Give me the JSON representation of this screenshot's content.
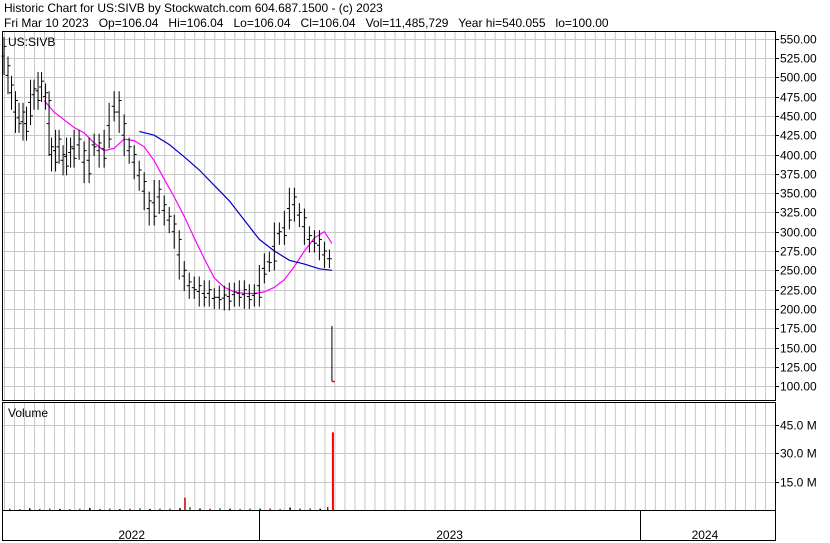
{
  "header": {
    "line1": "Historic Chart for US:SIVB by Stockwatch.com 604.687.1500 - (c) 2023",
    "line2": "Fri Mar 10 2023   Op=106.04   Hi=106.04   Lo=106.04   Cl=106.04   Vol=11,485,729   Year hi=540.055   lo=100.00"
  },
  "chart_data": {
    "type": "line",
    "title": "",
    "symbol_label": "US:SIVB",
    "volume_label": "Volume",
    "ylim": [
      82,
      560
    ],
    "yticks": [
      "550.00",
      "525.00",
      "500.00",
      "475.00",
      "450.00",
      "425.00",
      "400.00",
      "375.00",
      "350.00",
      "325.00",
      "300.00",
      "275.00",
      "250.00",
      "225.00",
      "200.00",
      "175.00",
      "150.00",
      "125.00",
      "100.00"
    ],
    "vol_ylim": [
      0,
      57
    ],
    "vol_ticks": [
      {
        "value": 45,
        "label": "45.0 M"
      },
      {
        "value": 30,
        "label": "30.0 M"
      },
      {
        "value": 15,
        "label": "15.0 M"
      }
    ],
    "x_periods": [
      {
        "label": "2022",
        "start": 0,
        "end": 51
      },
      {
        "label": "2023",
        "start": 51,
        "end": 127
      },
      {
        "label": "2024",
        "start": 127,
        "end": 153
      }
    ],
    "x_range": [
      0,
      153
    ],
    "price_points": [
      [
        0,
        540
      ],
      [
        0.8,
        515
      ],
      [
        1.5,
        490
      ],
      [
        2.3,
        470
      ],
      [
        3,
        440
      ],
      [
        3.8,
        455
      ],
      [
        4.5,
        430
      ],
      [
        5.3,
        450
      ],
      [
        6,
        485
      ],
      [
        6.8,
        470
      ],
      [
        7.5,
        495
      ],
      [
        8.3,
        480
      ],
      [
        9,
        470
      ],
      [
        9.5,
        410
      ],
      [
        10.3,
        390
      ],
      [
        11,
        420
      ],
      [
        11.8,
        400
      ],
      [
        12.5,
        385
      ],
      [
        13.3,
        410
      ],
      [
        14,
        395
      ],
      [
        15,
        420
      ],
      [
        16,
        405
      ],
      [
        17,
        375
      ],
      [
        18,
        410
      ],
      [
        19,
        415
      ],
      [
        20,
        395
      ],
      [
        21,
        420
      ],
      [
        22,
        455
      ],
      [
        23,
        470
      ],
      [
        24,
        440
      ],
      [
        25,
        410
      ],
      [
        26,
        400
      ],
      [
        27,
        380
      ],
      [
        28,
        365
      ],
      [
        29,
        340
      ],
      [
        30,
        320
      ],
      [
        31,
        355
      ],
      [
        32,
        335
      ],
      [
        33,
        320
      ],
      [
        34,
        310
      ],
      [
        35,
        290
      ],
      [
        36,
        250
      ],
      [
        37,
        235
      ],
      [
        38,
        225
      ],
      [
        39,
        230
      ],
      [
        40,
        215
      ],
      [
        41,
        225
      ],
      [
        42,
        215
      ],
      [
        43,
        212
      ],
      [
        44,
        218
      ],
      [
        45,
        210
      ],
      [
        46,
        222
      ],
      [
        47,
        215
      ],
      [
        48,
        225
      ],
      [
        49,
        212
      ],
      [
        50,
        220
      ],
      [
        51,
        215
      ],
      [
        52,
        245
      ],
      [
        53,
        260
      ],
      [
        54,
        262
      ],
      [
        55,
        300
      ],
      [
        56,
        295
      ],
      [
        57,
        315
      ],
      [
        58,
        345
      ],
      [
        59,
        325
      ],
      [
        60,
        318
      ],
      [
        61,
        295
      ],
      [
        62,
        285
      ],
      [
        63,
        290
      ],
      [
        64,
        275
      ],
      [
        65,
        265
      ],
      [
        65.5,
        106
      ]
    ],
    "ma_short": [
      [
        8,
        470
      ],
      [
        10,
        455
      ],
      [
        12,
        445
      ],
      [
        14,
        435
      ],
      [
        16,
        428
      ],
      [
        18,
        415
      ],
      [
        20,
        405
      ],
      [
        22,
        408
      ],
      [
        24,
        420
      ],
      [
        26,
        418
      ],
      [
        28,
        410
      ],
      [
        30,
        392
      ],
      [
        32,
        368
      ],
      [
        34,
        345
      ],
      [
        36,
        320
      ],
      [
        38,
        292
      ],
      [
        40,
        265
      ],
      [
        42,
        240
      ],
      [
        44,
        228
      ],
      [
        46,
        222
      ],
      [
        48,
        220
      ],
      [
        50,
        220
      ],
      [
        52,
        222
      ],
      [
        54,
        228
      ],
      [
        56,
        238
      ],
      [
        58,
        255
      ],
      [
        60,
        275
      ],
      [
        62,
        292
      ],
      [
        64,
        300
      ],
      [
        65.5,
        285
      ]
    ],
    "ma_long": [
      [
        27,
        430
      ],
      [
        30,
        425
      ],
      [
        33,
        413
      ],
      [
        36,
        397
      ],
      [
        39,
        380
      ],
      [
        42,
        360
      ],
      [
        45,
        340
      ],
      [
        48,
        315
      ],
      [
        51,
        290
      ],
      [
        54,
        275
      ],
      [
        57,
        263
      ],
      [
        60,
        258
      ],
      [
        63,
        252
      ],
      [
        65.5,
        250
      ]
    ],
    "volume_bars": [
      [
        1,
        0.7
      ],
      [
        3,
        0.5
      ],
      [
        5,
        0.9
      ],
      [
        7,
        0.6
      ],
      [
        9,
        0.8
      ],
      [
        11,
        0.6
      ],
      [
        13,
        0.5
      ],
      [
        15,
        0.7
      ],
      [
        17,
        1.1
      ],
      [
        19,
        0.6
      ],
      [
        21,
        0.8
      ],
      [
        23,
        0.5
      ],
      [
        25,
        0.7
      ],
      [
        27,
        0.9
      ],
      [
        29,
        0.6
      ],
      [
        31,
        0.7
      ],
      [
        33,
        0.8
      ],
      [
        35,
        1.0
      ],
      [
        36,
        6.5
      ],
      [
        37,
        1.5
      ],
      [
        39,
        0.8
      ],
      [
        41,
        0.7
      ],
      [
        43,
        0.9
      ],
      [
        45,
        0.7
      ],
      [
        47,
        0.6
      ],
      [
        49,
        0.8
      ],
      [
        51,
        0.7
      ],
      [
        53,
        0.8
      ],
      [
        55,
        0.6
      ],
      [
        57,
        1.3
      ],
      [
        59,
        0.8
      ],
      [
        61,
        0.9
      ],
      [
        63,
        0.7
      ],
      [
        64.5,
        1.6
      ],
      [
        65.5,
        41
      ]
    ],
    "colors": {
      "price": "#000000",
      "ma_short": "#ff00ff",
      "ma_long": "#0000cc",
      "last_bar": "#ff0000",
      "grid": "#c8c8c8",
      "frame": "#000000"
    },
    "grid": true
  }
}
